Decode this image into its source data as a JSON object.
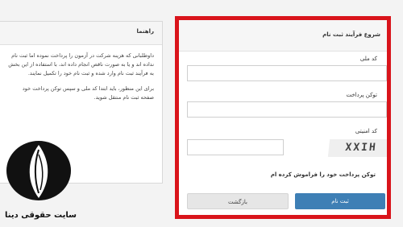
{
  "guide": {
    "title": "راهنما",
    "lines": [
      "داوطلبانی که هزینه شرکت در آزمون را پرداخت نموده اما ثبت نام",
      "نداده اند و یا به صورت ناقص انجام داده اند، با استفاده از این بخش",
      "به فرآیند ثبت نام وارد شده و ثبت نام خود را تکمیل نمایند.",
      "برای این منظور، باید ابتدا کد ملی و سپس توکن پرداخت خود",
      "صفحه ثبت نام منتقل شوید."
    ]
  },
  "form": {
    "title": "شروع فرآیند ثبت نام",
    "national_code_label": "کد ملی",
    "national_code_value": "",
    "payment_token_label": "توکن پرداخت",
    "payment_token_value": "",
    "security_code_label": "کد امنیتی",
    "security_code_value": "",
    "captcha_text": "XXIH",
    "forgot_token_link": "توکن پرداخت خود را فراموش کرده ام",
    "register_button": "ثبت نام",
    "back_button": "بازگشت"
  },
  "watermark": {
    "site_name": "سایت حقوقی دینا"
  },
  "colors": {
    "highlight": "#d9141b",
    "primary_button": "#3e7fb5"
  }
}
